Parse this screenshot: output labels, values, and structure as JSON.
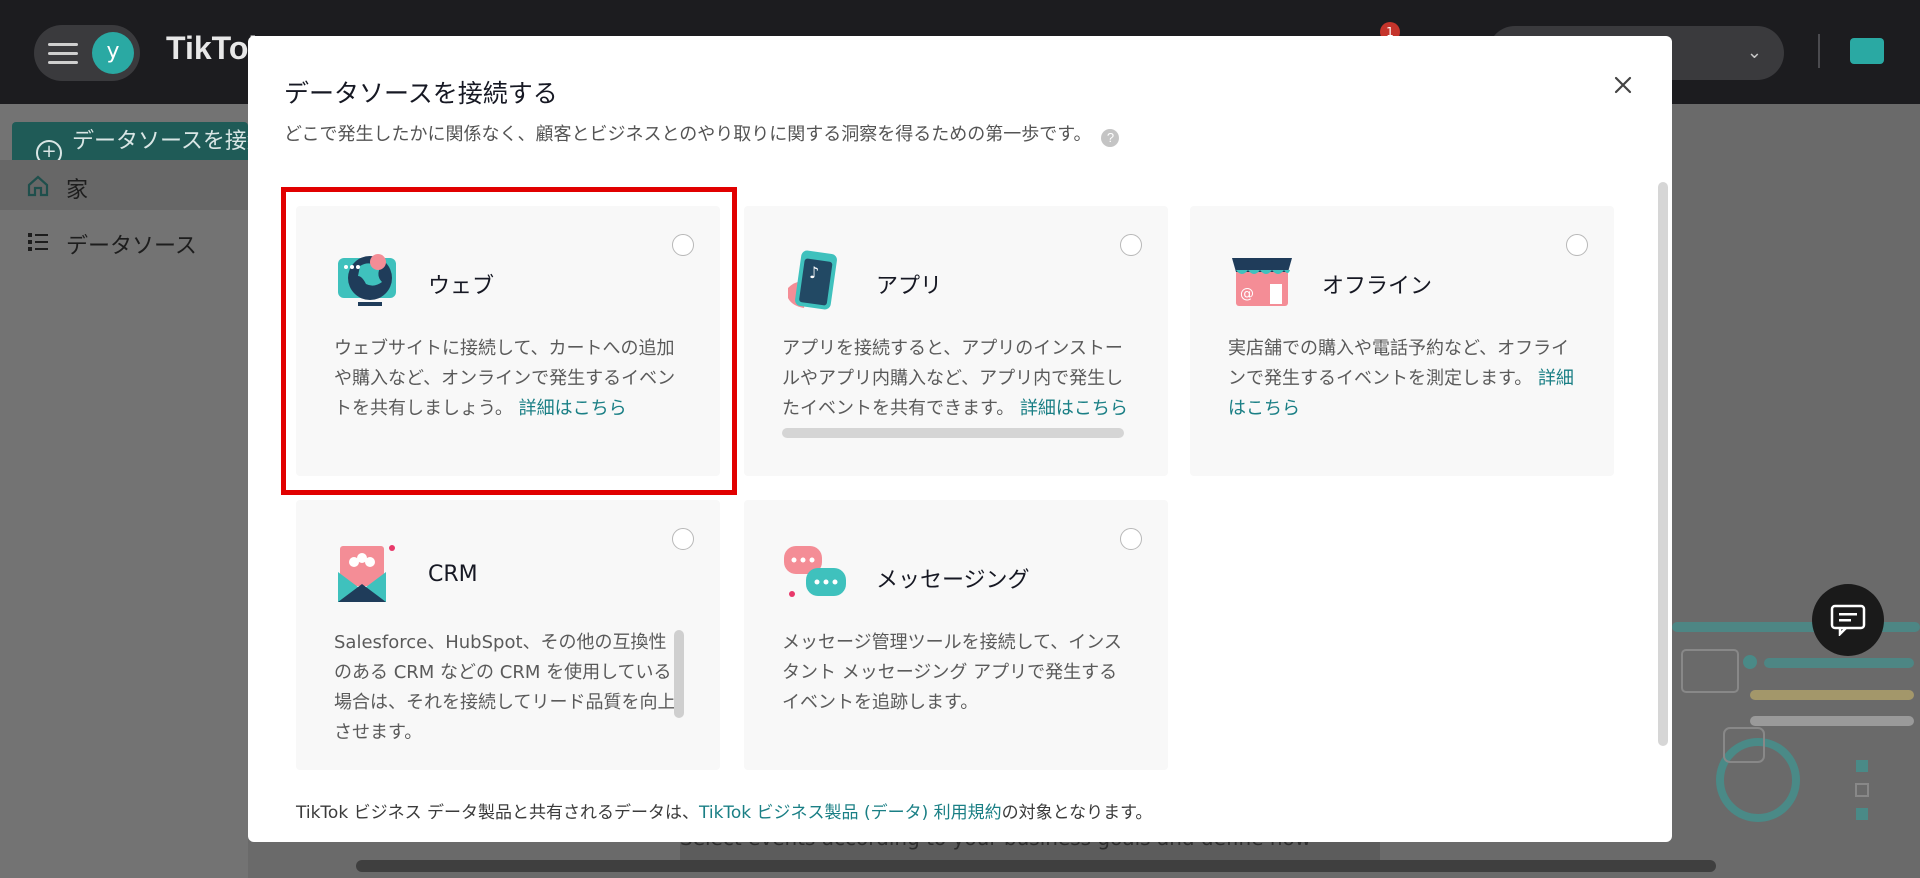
{
  "app": {
    "brand": "TikTok",
    "avatar_letter": "y",
    "notification_count": "1"
  },
  "sidebar": {
    "connect_button": "データソースを接続する",
    "items": [
      {
        "label": "家",
        "icon": "home-icon"
      },
      {
        "label": "データソース",
        "icon": "list-icon"
      }
    ]
  },
  "background": {
    "caption": "Select events according to your business goals and define how"
  },
  "modal": {
    "title": "データソースを接続する",
    "subtitle": "どこで発生したかに関係なく、顧客とビジネスとのやり取りに関する洞察を得るための第一歩です。",
    "help_icon": "?",
    "cards": [
      {
        "id": "web",
        "title": "ウェブ",
        "icon": "web-globe-icon",
        "desc": "ウェブサイトに接続して、カートへの追加や購入など、オンラインで発生するイベントを共有しましょう。",
        "link": "詳細はこちら"
      },
      {
        "id": "app",
        "title": "アプリ",
        "icon": "app-phone-icon",
        "desc": "アプリを接続すると、アプリのインストールやアプリ内購入など、アプリ内で発生したイベントを共有できます。",
        "link": "詳細はこちら"
      },
      {
        "id": "offline",
        "title": "オフライン",
        "icon": "store-icon",
        "desc": "実店舗での購入や電話予約など、オフラインで発生するイベントを測定します。",
        "link": "詳細はこちら"
      },
      {
        "id": "crm",
        "title": "CRM",
        "icon": "crm-mail-icon",
        "desc": "Salesforce、HubSpot、その他の互換性のある CRM などの CRM を使用している場合は、それを接続してリード品質を向上させます。",
        "link": ""
      },
      {
        "id": "messaging",
        "title": "メッセージング",
        "icon": "chat-bubbles-icon",
        "desc": "メッセージ管理ツールを接続して、インスタント メッセージング アプリで発生するイベントを追跡します。",
        "link": ""
      }
    ],
    "footer_prefix": "TikTok ビジネス データ製品と共有されるデータは、",
    "footer_link": "TikTok ビジネス製品 (データ) 利用規約",
    "footer_suffix": "の対象となります。"
  },
  "colors": {
    "accent": "#1a7f85",
    "highlight": "#e10000",
    "teal": "#2aa9a3"
  }
}
